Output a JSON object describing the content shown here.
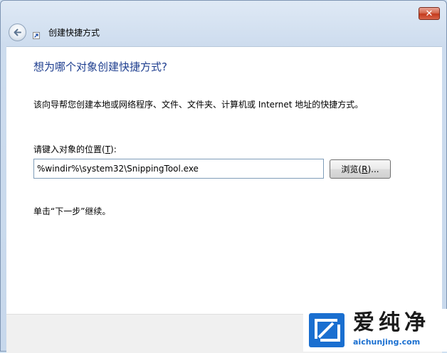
{
  "window": {
    "title": "创建快捷方式",
    "close_glyph": "✕"
  },
  "page": {
    "heading": "想为哪个对象创建快捷方式?",
    "description": "该向导帮您创建本地或网络程序、文件、文件夹、计算机或 Internet 地址的快捷方式。",
    "location_label_prefix": "请键入对象的位置(",
    "location_label_key": "T",
    "location_label_suffix": "):",
    "location_value": "%windir%\\system32\\SnippingTool.exe",
    "browse_prefix": "浏览(",
    "browse_key": "R",
    "browse_suffix": ")...",
    "hint": "单击“下一步”继续。"
  },
  "watermark": {
    "name": "爱纯净",
    "url": "aichunjing.com"
  },
  "colors": {
    "heading": "#1e3e8f",
    "close_button": "#c4391c",
    "watermark_blue": "#1a6fd0"
  },
  "icons": {
    "back": "back-arrow-icon",
    "close": "close-icon",
    "shortcut": "shortcut-arrow-icon",
    "watermark": "logo-icon"
  }
}
